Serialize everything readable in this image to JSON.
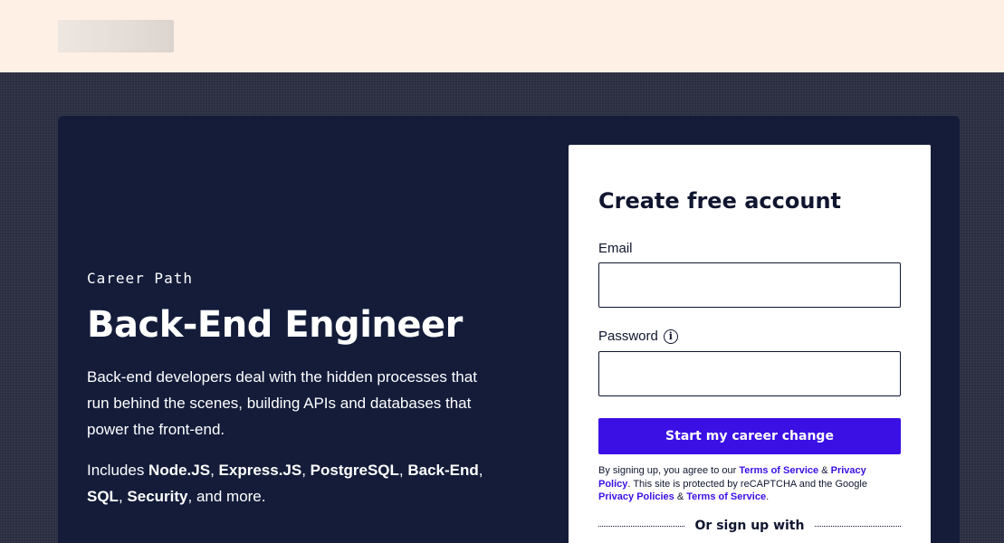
{
  "hero": {
    "eyebrow": "Career Path",
    "title": "Back-End Engineer",
    "description": "Back-end developers deal with the hidden processes that run behind the scenes, building APIs and databases that power the front-end.",
    "includes_prefix": "Includes ",
    "includes_topics": [
      "Node.JS",
      "Express.JS",
      "PostgreSQL",
      "Back-End",
      "SQL",
      "Security"
    ],
    "includes_suffix": ", and more."
  },
  "signup": {
    "title": "Create free account",
    "email_label": "Email",
    "email_value": "",
    "password_label": "Password",
    "password_value": "",
    "submit_label": "Start my career change",
    "legal": {
      "t1": "By signing up, you agree to our ",
      "terms_link": "Terms of Service",
      "t2": " & ",
      "privacy_link": "Privacy Policy",
      "t3": ". This site is protected by reCAPTCHA and the Google ",
      "google_privacy_link": "Privacy Policies",
      "t4": " & ",
      "google_terms_link": "Terms of Service",
      "t5": "."
    },
    "alt_signup_label": "Or sign up with"
  },
  "colors": {
    "accent": "#3a10e5",
    "hero_bg": "#141c3a",
    "header_bg": "#fff0e6",
    "page_bg": "#2a2e40"
  },
  "icons": {
    "password_info": "info-icon"
  }
}
